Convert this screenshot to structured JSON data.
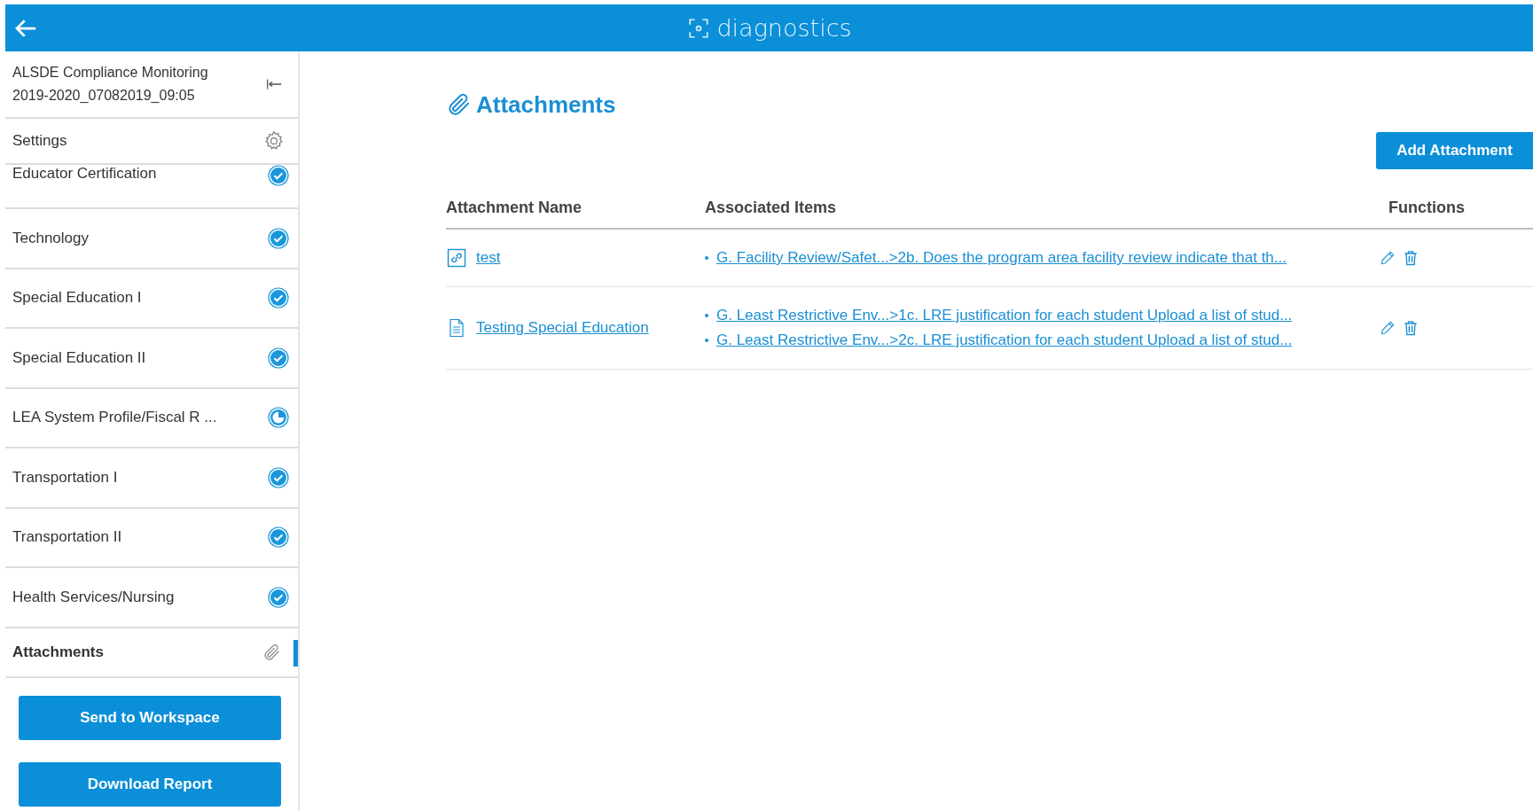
{
  "header": {
    "title": "diagnostics"
  },
  "sidebar": {
    "title": "ALSDE Compliance Monitoring 2019-2020_07082019_09:05",
    "settings_label": "Settings",
    "items": [
      {
        "label": "Educator Certification",
        "kind": "section",
        "complete": true,
        "selected": false
      },
      {
        "label": "Technology",
        "kind": "section",
        "complete": true,
        "selected": false
      },
      {
        "label": "Special Education I",
        "kind": "section",
        "complete": true,
        "selected": false
      },
      {
        "label": "Special Education II",
        "kind": "section",
        "complete": true,
        "selected": false
      },
      {
        "label": "LEA System Profile/Fiscal R ...",
        "kind": "section",
        "complete": false,
        "selected": false
      },
      {
        "label": "Transportation I",
        "kind": "section",
        "complete": true,
        "selected": false
      },
      {
        "label": "Transportation II",
        "kind": "section",
        "complete": true,
        "selected": false
      },
      {
        "label": "Health Services/Nursing",
        "kind": "section",
        "complete": true,
        "selected": false
      },
      {
        "label": "Attachments",
        "kind": "attachments",
        "selected": true
      }
    ],
    "buttons": [
      "Send to Workspace",
      "Download Report"
    ]
  },
  "main": {
    "title": "Attachments",
    "add_button": "Add Attachment",
    "table": {
      "columns": [
        "Attachment Name",
        "Associated Items",
        "Functions"
      ],
      "rows": [
        {
          "name": "test",
          "kind": "link",
          "items": [
            "G. Facility Review/Safet...>2b. Does the program area facility review indicate that th..."
          ]
        },
        {
          "name": "Testing Special Education",
          "kind": "file",
          "items": [
            "G. Least Restrictive Env...>1c. LRE justification for each student Upload a list of stud...",
            "G. Least Restrictive Env...>2c. LRE justification for each student Upload a list of stud..."
          ]
        }
      ]
    }
  }
}
